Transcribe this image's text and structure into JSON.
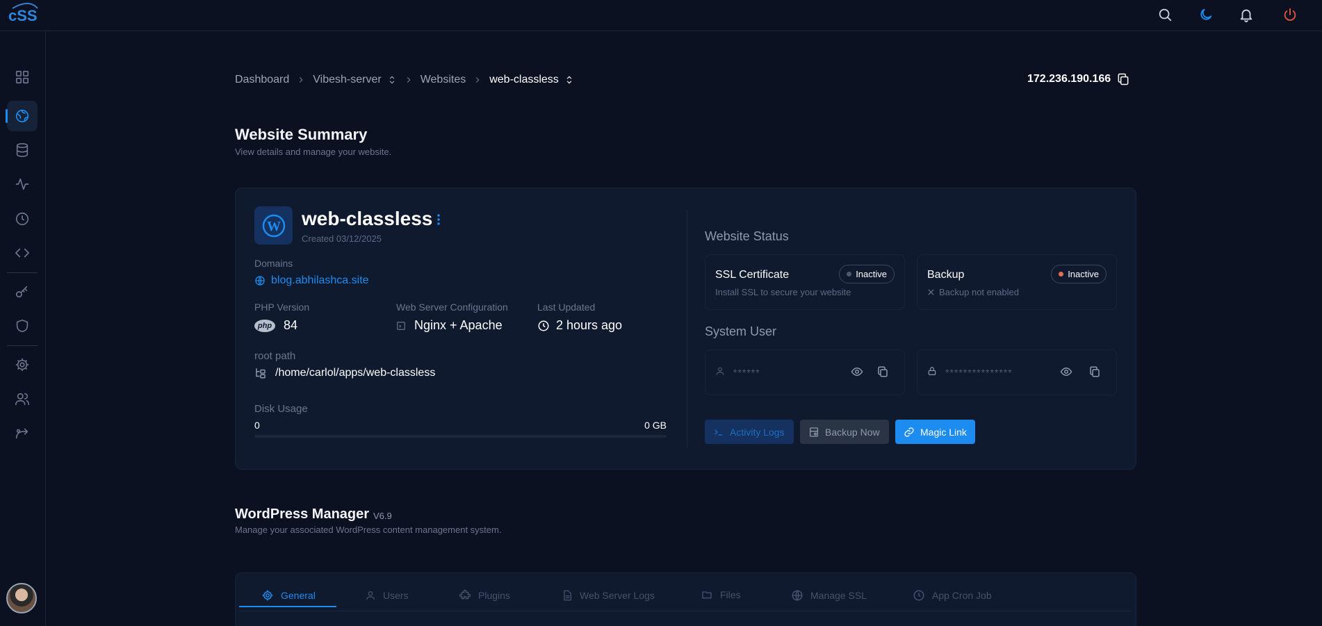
{
  "brand": {
    "logo_icon": "css-cloud-logo",
    "accent": "#1d8cf0"
  },
  "topbar": {
    "icons": [
      "search-icon",
      "moon-icon",
      "bell-icon",
      "power-icon"
    ]
  },
  "sidebar": {
    "items": [
      {
        "icon": "dashboard-grid-icon",
        "active": false
      },
      {
        "icon": "globe-icon",
        "active": true
      },
      {
        "icon": "database-icon",
        "active": false
      },
      {
        "icon": "activity-icon",
        "active": false
      },
      {
        "icon": "clock-icon",
        "active": false
      },
      {
        "icon": "code-icon",
        "active": false
      },
      {
        "icon": "key-icon",
        "active": false
      },
      {
        "icon": "shield-icon",
        "active": false
      },
      {
        "icon": "gear-icon",
        "active": false
      },
      {
        "icon": "users-icon",
        "active": false
      },
      {
        "icon": "route-icon",
        "active": false
      }
    ]
  },
  "breadcrumb": {
    "items": [
      "Dashboard",
      "Vibesh-server",
      "Websites",
      "web-classless"
    ]
  },
  "server_ip": "172.236.190.166",
  "page": {
    "title": "Website Summary",
    "subtitle": "View details and manage your website."
  },
  "site": {
    "name": "web-classless",
    "created": "Created 03/12/2025",
    "domains_label": "Domains",
    "domain": "blog.abhilashca.site",
    "php_label": "PHP Version",
    "php_badge": "php",
    "php_version": "84",
    "webserver_label": "Web Server Configuration",
    "webserver": "Nginx + Apache",
    "updated_label": "Last Updated",
    "updated": "2 hours ago",
    "root_label": "root path",
    "root_path": "/home/carlol/apps/web-classless",
    "disk_label": "Disk Usage",
    "disk_min": "0",
    "disk_max": "0 GB",
    "disk_used_fraction": 0
  },
  "status": {
    "title": "Website Status",
    "ssl": {
      "title": "SSL Certificate",
      "badge": "Inactive",
      "desc": "Install SSL to secure your website",
      "dot_color": "#4d586d"
    },
    "backup": {
      "title": "Backup",
      "badge": "Inactive",
      "desc": "Backup not enabled",
      "dot_color": "#e0704e"
    }
  },
  "system_user": {
    "title": "System User",
    "username_mask": "******",
    "password_mask": "***************"
  },
  "actions": {
    "activity_logs": "Activity Logs",
    "backup_now": "Backup Now",
    "magic_link": "Magic Link"
  },
  "wp_manager": {
    "title": "WordPress Manager",
    "version": "V6.9",
    "subtitle": "Manage your associated WordPress content management system.",
    "tabs": [
      "General",
      "Users",
      "Plugins",
      "Web Server Logs",
      "Files",
      "Manage SSL",
      "App Cron Job"
    ]
  }
}
